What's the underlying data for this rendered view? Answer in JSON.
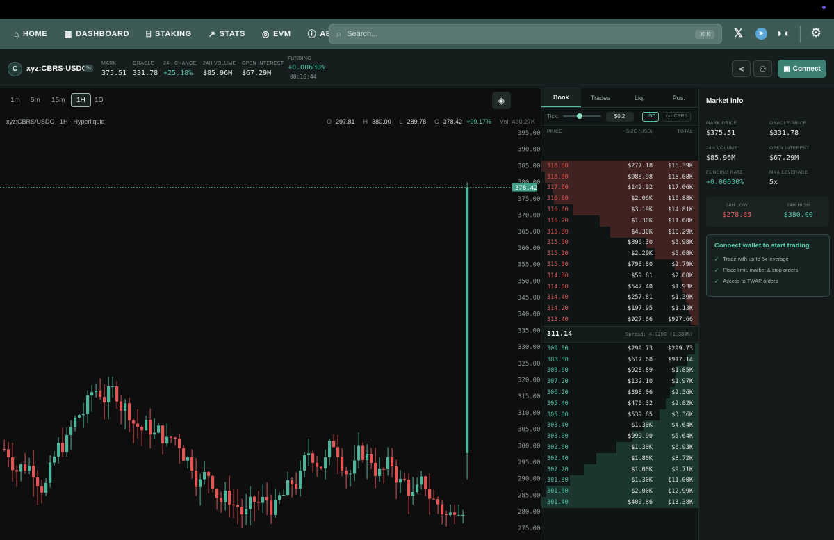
{
  "nav": {
    "items": [
      {
        "label": "HOME",
        "icon": "home-icon"
      },
      {
        "label": "DASHBOARD",
        "icon": "grid-icon"
      },
      {
        "label": "STAKING",
        "icon": "bank-icon"
      },
      {
        "label": "STATS",
        "icon": "trend-icon"
      },
      {
        "label": "EVM",
        "icon": "evm-icon"
      },
      {
        "label": "ABOUT",
        "icon": "info-icon"
      }
    ],
    "search_placeholder": "Search...",
    "search_shortcut": "⌘ K"
  },
  "ticker": {
    "coin_letter": "C",
    "pair": "xyz:CBRS-USDC",
    "leverage": "5x",
    "stats": [
      {
        "label": "MARK",
        "value": "375.51",
        "tone": "neutral"
      },
      {
        "label": "ORACLE",
        "value": "331.78",
        "tone": "neutral"
      },
      {
        "label": "24H CHANGE",
        "value": "+25.18%",
        "tone": "green"
      },
      {
        "label": "24H VOLUME",
        "value": "$85.96M",
        "tone": "neutral"
      },
      {
        "label": "OPEN INTEREST",
        "value": "$67.29M",
        "tone": "neutral"
      }
    ],
    "funding": {
      "label": "FUNDING",
      "value": "+0.00630%",
      "countdown": "00:16:44"
    },
    "connect_label": "Connect"
  },
  "chart": {
    "timeframes": [
      "1m",
      "5m",
      "15m",
      "1H",
      "1D"
    ],
    "active_timeframe": "1H",
    "info": "xyz:CBRS/USDC · 1H · Hyperliquid",
    "ohlc": {
      "O": "297.81",
      "H": "380.00",
      "L": "289.78",
      "C": "378.42",
      "change": "+99.17%",
      "volume": "Vol: 430.27K"
    },
    "last_price_label": "378.42",
    "last_price": 378.42,
    "y_ticks": [
      395,
      390,
      385,
      380,
      375,
      370,
      365,
      360,
      355,
      350,
      345,
      340,
      335,
      330,
      325,
      320,
      315,
      310,
      305,
      300,
      295,
      290,
      285,
      280,
      275
    ],
    "y_tick_labels": [
      "395.00",
      "390.00",
      "385.00",
      "380.00",
      "375.00",
      "370.00",
      "365.00",
      "360.00",
      "355.00",
      "350.00",
      "345.00",
      "340.00",
      "335.00",
      "330.00",
      "325.00",
      "320.00",
      "315.00",
      "310.00",
      "305.00",
      "300.00",
      "295.00",
      "290.00",
      "285.00",
      "280.00",
      "275.00"
    ],
    "colors": {
      "up": "#4fb49a",
      "down": "#e05656"
    }
  },
  "book": {
    "tabs": [
      "Book",
      "Trades",
      "Liq.",
      "Pos."
    ],
    "active_tab": "Book",
    "tick_label": "Tick:",
    "tick_value": "$0.2",
    "unit_usd": "USD",
    "unit_coin": "xyz:CBRS",
    "headers": {
      "price": "PRICE",
      "size": "SIZE (USD)",
      "total": "TOTAL"
    },
    "asks": [
      {
        "price": "318.60",
        "size": "$277.18",
        "total": "$18.39K",
        "depth": 1.0
      },
      {
        "price": "318.00",
        "size": "$988.98",
        "total": "$18.08K",
        "depth": 0.98
      },
      {
        "price": "317.60",
        "size": "$142.92",
        "total": "$17.06K",
        "depth": 0.93
      },
      {
        "price": "316.80",
        "size": "$2.06K",
        "total": "$16.88K",
        "depth": 0.92
      },
      {
        "price": "316.60",
        "size": "$3.19K",
        "total": "$14.81K",
        "depth": 0.8
      },
      {
        "price": "316.20",
        "size": "$1.30K",
        "total": "$11.60K",
        "depth": 0.63
      },
      {
        "price": "315.80",
        "size": "$4.30K",
        "total": "$10.29K",
        "depth": 0.56
      },
      {
        "price": "315.60",
        "size": "$896.30",
        "total": "$5.98K",
        "depth": 0.33
      },
      {
        "price": "315.20",
        "size": "$2.29K",
        "total": "$5.08K",
        "depth": 0.28
      },
      {
        "price": "315.00",
        "size": "$793.80",
        "total": "$2.79K",
        "depth": 0.15
      },
      {
        "price": "314.80",
        "size": "$59.81",
        "total": "$2.00K",
        "depth": 0.11
      },
      {
        "price": "314.60",
        "size": "$547.40",
        "total": "$1.93K",
        "depth": 0.1
      },
      {
        "price": "314.40",
        "size": "$257.81",
        "total": "$1.39K",
        "depth": 0.08
      },
      {
        "price": "314.20",
        "size": "$197.95",
        "total": "$1.13K",
        "depth": 0.06
      },
      {
        "price": "313.40",
        "size": "$927.66",
        "total": "$927.66",
        "depth": 0.05
      }
    ],
    "mid_price": "311.14",
    "spread": "Spread: 4.3200 (1.388%)",
    "bids": [
      {
        "price": "309.00",
        "size": "$299.73",
        "total": "$299.73",
        "depth": 0.02
      },
      {
        "price": "308.80",
        "size": "$617.60",
        "total": "$917.14",
        "depth": 0.07
      },
      {
        "price": "308.60",
        "size": "$928.89",
        "total": "$1.85K",
        "depth": 0.14
      },
      {
        "price": "307.20",
        "size": "$132.10",
        "total": "$1.97K",
        "depth": 0.15
      },
      {
        "price": "306.20",
        "size": "$398.06",
        "total": "$2.36K",
        "depth": 0.18
      },
      {
        "price": "305.40",
        "size": "$470.32",
        "total": "$2.82K",
        "depth": 0.21
      },
      {
        "price": "305.00",
        "size": "$539.85",
        "total": "$3.36K",
        "depth": 0.25
      },
      {
        "price": "303.40",
        "size": "$1.30K",
        "total": "$4.64K",
        "depth": 0.35
      },
      {
        "price": "303.00",
        "size": "$999.90",
        "total": "$5.64K",
        "depth": 0.42
      },
      {
        "price": "302.60",
        "size": "$1.30K",
        "total": "$6.93K",
        "depth": 0.52
      },
      {
        "price": "302.40",
        "size": "$1.80K",
        "total": "$8.72K",
        "depth": 0.65
      },
      {
        "price": "302.20",
        "size": "$1.00K",
        "total": "$9.71K",
        "depth": 0.73
      },
      {
        "price": "301.80",
        "size": "$1.30K",
        "total": "$11.00K",
        "depth": 0.82
      },
      {
        "price": "301.60",
        "size": "$2.00K",
        "total": "$12.99K",
        "depth": 0.97
      },
      {
        "price": "301.40",
        "size": "$400.86",
        "total": "$13.38K",
        "depth": 1.0
      }
    ]
  },
  "market_info": {
    "title": "Market Info",
    "fields": [
      {
        "label": "MARK PRICE",
        "value": "$375.51",
        "tone": "neutral"
      },
      {
        "label": "ORACLE PRICE",
        "value": "$331.78",
        "tone": "neutral"
      },
      {
        "label": "24H VOLUME",
        "value": "$85.96M",
        "tone": "neutral"
      },
      {
        "label": "OPEN INTEREST",
        "value": "$67.29M",
        "tone": "neutral"
      },
      {
        "label": "FUNDING RATE",
        "value": "+0.00630%",
        "tone": "green"
      },
      {
        "label": "MAX LEVERAGE",
        "value": "5x",
        "tone": "neutral"
      }
    ],
    "low": {
      "label": "24H LOW",
      "value": "$278.85"
    },
    "high": {
      "label": "24H HIGH",
      "value": "$380.00"
    },
    "cta": {
      "title": "Connect wallet to start trading",
      "bullets": [
        "Trade with up to 5x leverage",
        "Place limit, market & stop orders",
        "Access to TWAP orders"
      ]
    }
  }
}
